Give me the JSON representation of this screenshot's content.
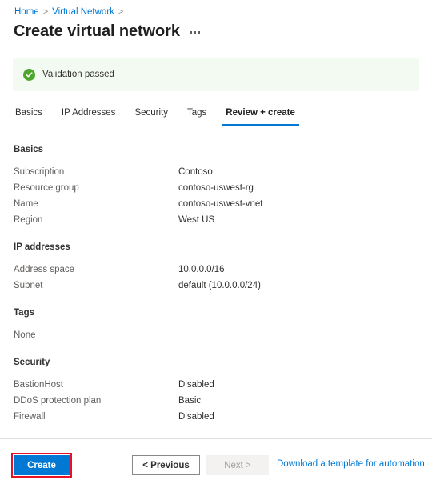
{
  "breadcrumb": {
    "items": [
      {
        "label": "Home"
      },
      {
        "label": "Virtual Network"
      }
    ],
    "separator": ">"
  },
  "header": {
    "title": "Create virtual network",
    "more_menu": "more-commands"
  },
  "banner": {
    "icon": "success-check-icon",
    "text": "Validation passed",
    "background_color": "#f3faf1",
    "icon_color": "#4ca72c"
  },
  "tabs": [
    {
      "label": "Basics",
      "active": false
    },
    {
      "label": "IP Addresses",
      "active": false
    },
    {
      "label": "Security",
      "active": false
    },
    {
      "label": "Tags",
      "active": false
    },
    {
      "label": "Review + create",
      "active": true
    }
  ],
  "sections": [
    {
      "title": "Basics",
      "rows": [
        {
          "label": "Subscription",
          "value": "Contoso"
        },
        {
          "label": "Resource group",
          "value": "contoso-uswest-rg"
        },
        {
          "label": "Name",
          "value": "contoso-uswest-vnet"
        },
        {
          "label": "Region",
          "value": "West US"
        }
      ]
    },
    {
      "title": "IP addresses",
      "rows": [
        {
          "label": "Address space",
          "value": "10.0.0.0/16"
        },
        {
          "label": "Subnet",
          "value": "default (10.0.0.0/24)"
        }
      ]
    },
    {
      "title": "Tags",
      "text": "None",
      "rows": []
    },
    {
      "title": "Security",
      "rows": [
        {
          "label": "BastionHost",
          "value": "Disabled"
        },
        {
          "label": "DDoS protection plan",
          "value": "Basic"
        },
        {
          "label": "Firewall",
          "value": "Disabled"
        }
      ]
    }
  ],
  "footer": {
    "create_label": "Create",
    "previous_label": "< Previous",
    "next_label": "Next >",
    "template_link_label": "Download a template for automation",
    "highlight_color": "#e81123",
    "primary_color": "#0078d4"
  }
}
